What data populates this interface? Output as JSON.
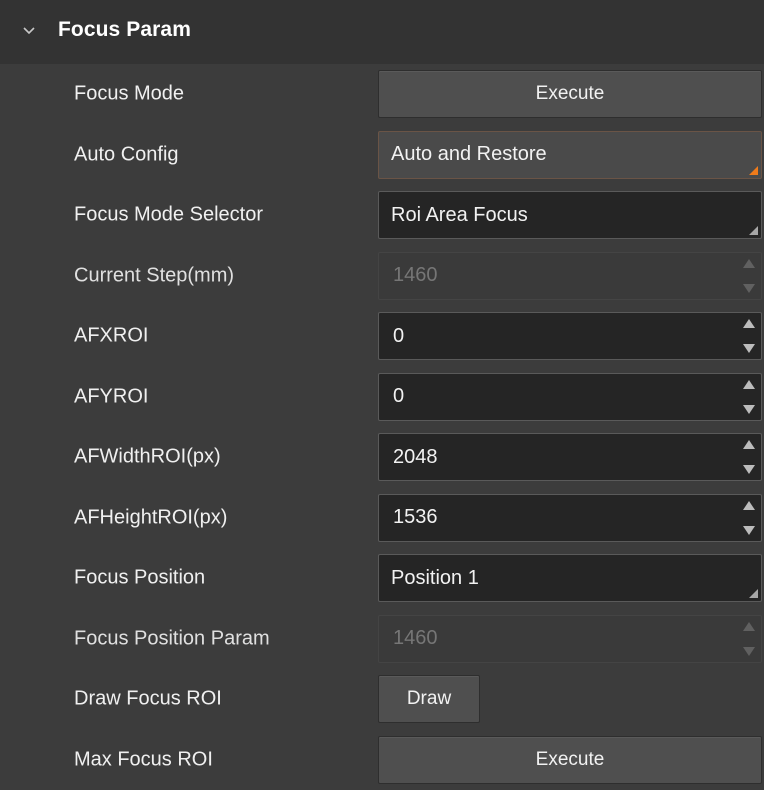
{
  "panel": {
    "title": "Focus Param",
    "collapse_icon": "chevron-down-icon"
  },
  "rows": {
    "focus_mode": {
      "label": "Focus Mode",
      "button": "Execute"
    },
    "auto_config": {
      "label": "Auto Config",
      "value": "Auto and Restore"
    },
    "focus_mode_selector": {
      "label": "Focus Mode Selector",
      "value": "Roi Area Focus"
    },
    "current_step": {
      "label": "Current Step(mm)",
      "value": "1460"
    },
    "afxroi": {
      "label": "AFXROI",
      "value": "0"
    },
    "afyroi": {
      "label": "AFYROI",
      "value": "0"
    },
    "afwidthroi": {
      "label": "AFWidthROI(px)",
      "value": "2048"
    },
    "afheightroi": {
      "label": "AFHeightROI(px)",
      "value": "1536"
    },
    "focus_position": {
      "label": "Focus Position",
      "value": "Position 1"
    },
    "focus_position_param": {
      "label": "Focus Position Param",
      "value": "1460"
    },
    "draw_focus_roi": {
      "label": "Draw Focus ROI",
      "button": "Draw"
    },
    "max_focus_roi": {
      "label": "Max Focus ROI",
      "button": "Execute"
    }
  },
  "colors": {
    "background": "#3c3c3c",
    "header": "#333333",
    "input_background": "#252525",
    "accent": "#f07b1a"
  }
}
